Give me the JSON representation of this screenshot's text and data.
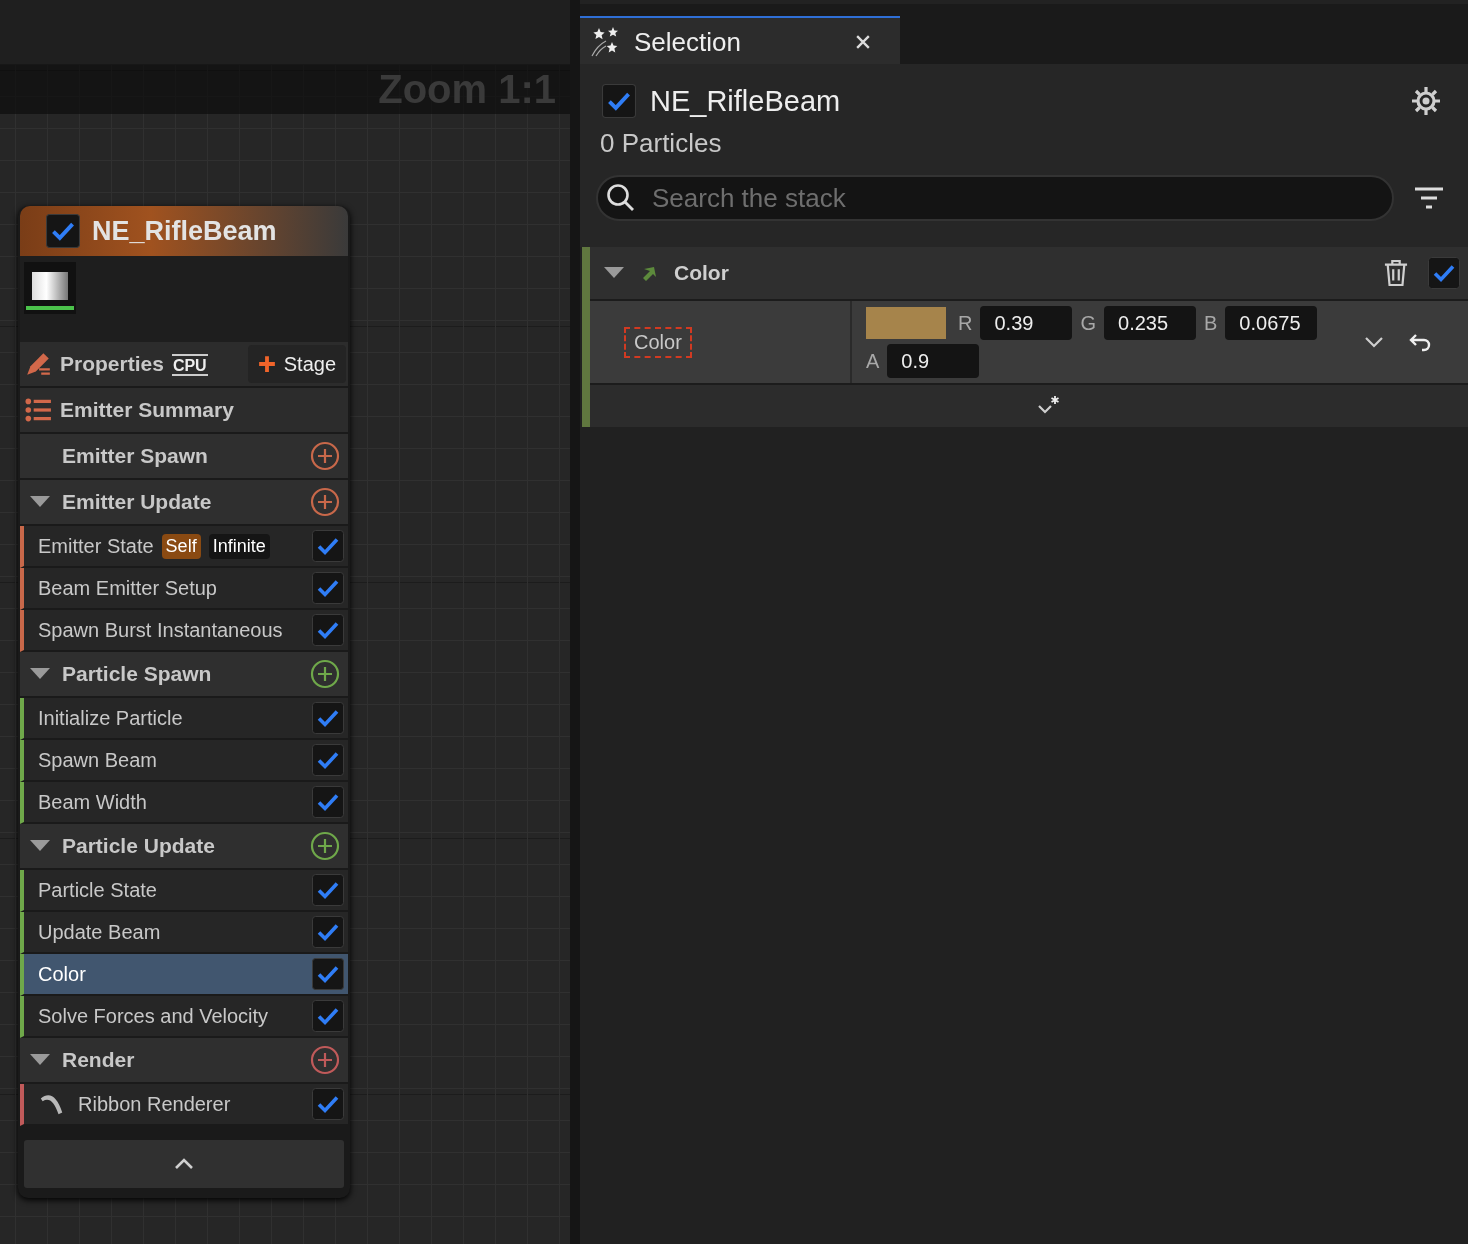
{
  "graph": {
    "zoom_label": "Zoom 1:1",
    "emitter_node": {
      "enabled": true,
      "title": "NE_RifleBeam",
      "properties_label": "Properties",
      "sim_target": "CPU",
      "stage_button": "Stage",
      "summary_label": "Emitter Summary",
      "groups": [
        {
          "name": "Emitter Spawn",
          "color": "#c8684a"
        },
        {
          "name": "Emitter Update",
          "color": "#c8684a",
          "items": [
            {
              "label": "Emitter State",
              "kind": "module",
              "enabled": true,
              "selected": false,
              "tags": [
                {
                  "text": "Self",
                  "kind": "scope"
                },
                {
                  "text": "Infinite",
                  "kind": "mode"
                }
              ]
            },
            {
              "label": "Beam Emitter Setup",
              "kind": "module",
              "enabled": true,
              "selected": false
            },
            {
              "label": "Spawn Burst Instantaneous",
              "kind": "module",
              "enabled": true,
              "selected": false
            }
          ]
        },
        {
          "name": "Particle Spawn",
          "color": "#6fa84a",
          "items": [
            {
              "label": "Initialize Particle",
              "kind": "module",
              "enabled": true,
              "selected": false
            },
            {
              "label": "Spawn Beam",
              "kind": "module",
              "enabled": true,
              "selected": false
            },
            {
              "label": "Beam Width",
              "kind": "module",
              "enabled": true,
              "selected": false
            }
          ]
        },
        {
          "name": "Particle Update",
          "color": "#6fa84a",
          "items": [
            {
              "label": "Particle State",
              "kind": "module",
              "enabled": true,
              "selected": false
            },
            {
              "label": "Update Beam",
              "kind": "module",
              "enabled": true,
              "selected": false
            },
            {
              "label": "Color",
              "kind": "module",
              "enabled": true,
              "selected": true
            },
            {
              "label": "Solve Forces and Velocity",
              "kind": "module",
              "enabled": true,
              "selected": false
            }
          ]
        },
        {
          "name": "Render",
          "color": "#c05a5a",
          "items": [
            {
              "label": "Ribbon Renderer",
              "kind": "renderer",
              "enabled": true,
              "selected": false
            }
          ]
        }
      ]
    }
  },
  "selection_panel": {
    "tab": {
      "title": "Selection",
      "selected": true
    },
    "header": {
      "enabled": true,
      "name": "NE_RifleBeam",
      "particle_count": "0 Particles"
    },
    "search": {
      "placeholder": "Search the stack"
    },
    "module": {
      "name": "Color",
      "enabled": true,
      "params": [
        {
          "label": "Color",
          "components": [
            {
              "axis": "R",
              "value": "0.39"
            },
            {
              "axis": "G",
              "value": "0.235"
            },
            {
              "axis": "B",
              "value": "0.0675"
            },
            {
              "axis": "A",
              "value": "0.9"
            }
          ]
        }
      ]
    }
  }
}
